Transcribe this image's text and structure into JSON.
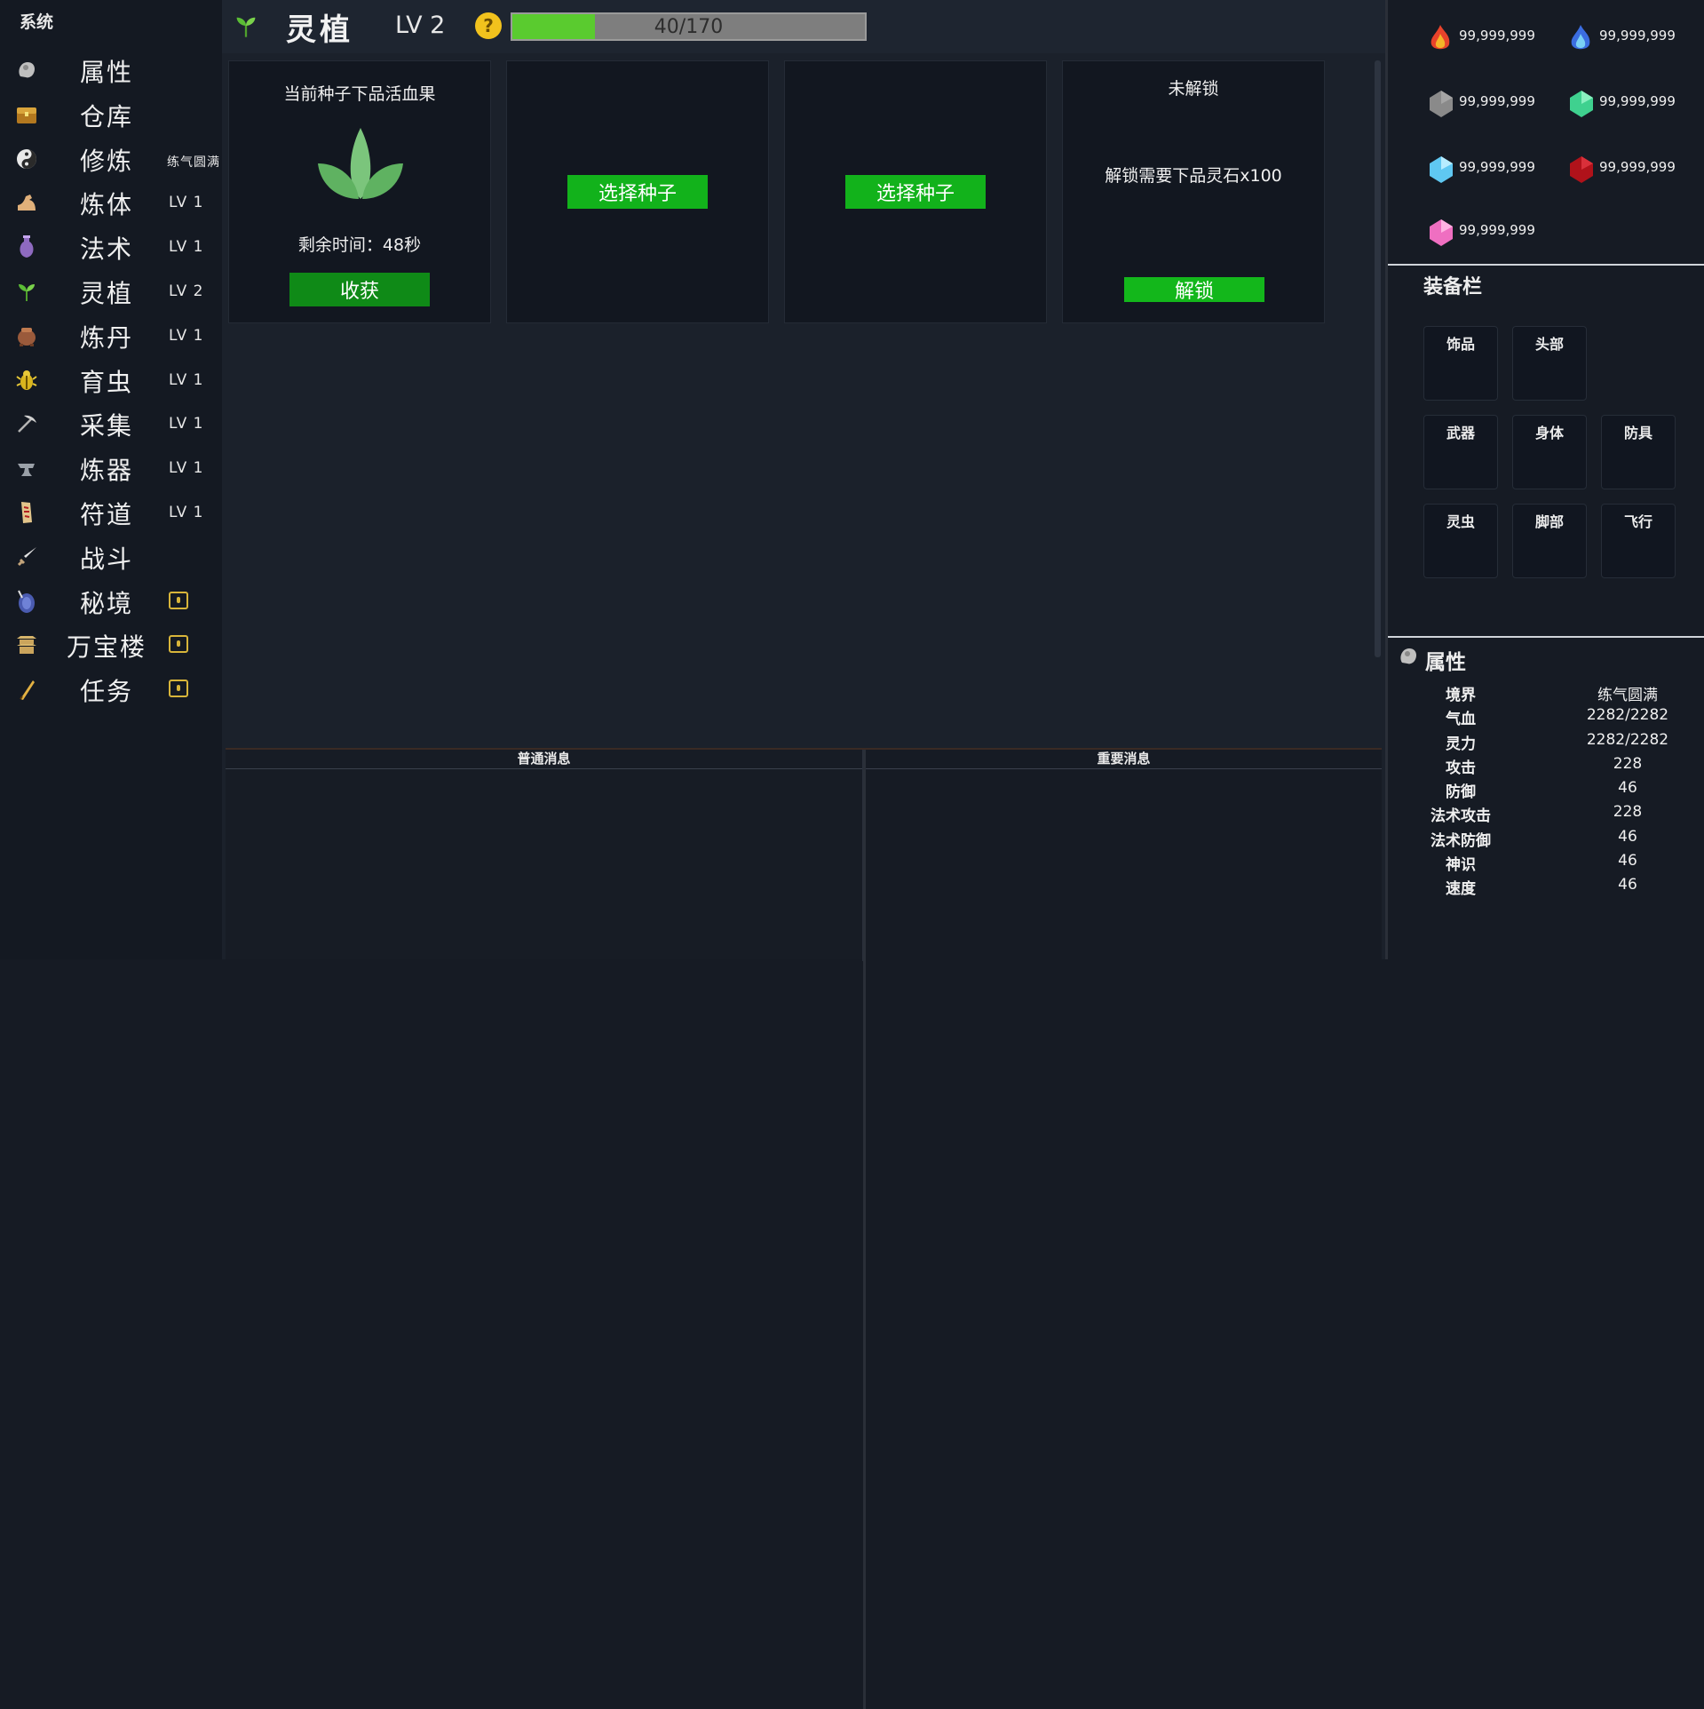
{
  "sidebar": {
    "system_label": "系统",
    "items": [
      {
        "label": "属性",
        "level": "",
        "icon": "attribute-icon"
      },
      {
        "label": "仓库",
        "level": "",
        "icon": "chest-icon"
      },
      {
        "label": "修炼",
        "level": "练气圆满",
        "icon": "yinyang-icon"
      },
      {
        "label": "炼体",
        "level": "LV 1",
        "icon": "arm-icon"
      },
      {
        "label": "法术",
        "level": "LV 1",
        "icon": "potion-icon"
      },
      {
        "label": "灵植",
        "level": "LV 2",
        "icon": "sprout-icon"
      },
      {
        "label": "炼丹",
        "level": "LV 1",
        "icon": "cauldron-icon"
      },
      {
        "label": "育虫",
        "level": "LV 1",
        "icon": "bug-icon"
      },
      {
        "label": "采集",
        "level": "LV 1",
        "icon": "pickaxe-icon"
      },
      {
        "label": "炼器",
        "level": "LV 1",
        "icon": "anvil-icon"
      },
      {
        "label": "符道",
        "level": "LV 1",
        "icon": "talisman-icon"
      },
      {
        "label": "战斗",
        "level": "",
        "icon": "sword-icon"
      },
      {
        "label": "秘境",
        "level": "",
        "icon": "portal-icon",
        "locked": true
      },
      {
        "label": "万宝楼",
        "level": "",
        "icon": "tower-icon",
        "locked": true
      },
      {
        "label": "任务",
        "level": "",
        "icon": "quill-icon",
        "locked": true
      }
    ]
  },
  "main": {
    "title": "灵植",
    "level": "LV 2",
    "help_glyph": "?",
    "xp_text": "40/170",
    "xp_fraction": 0.235,
    "plots": [
      {
        "title": "当前种子下品活血果",
        "timer": "剩余时间：48秒",
        "button": "收获"
      },
      {
        "button": "选择种子"
      },
      {
        "button": "选择种子"
      },
      {
        "title": "未解锁",
        "requirement": "解锁需要下品灵石x100",
        "button": "解锁"
      }
    ],
    "messages": {
      "normal": "普通消息",
      "important": "重要消息"
    }
  },
  "resources": [
    {
      "gem": "fire-gem-icon",
      "amount": "99,999,999",
      "color": "#e8432b"
    },
    {
      "gem": "blue-flame-gem-icon",
      "amount": "99,999,999",
      "color": "#3b6de0"
    },
    {
      "gem": "gray-gem-icon",
      "amount": "99,999,999",
      "color": "#8a8a8a"
    },
    {
      "gem": "green-gem-icon",
      "amount": "99,999,999",
      "color": "#3fd18f"
    },
    {
      "gem": "cyan-gem-icon",
      "amount": "99,999,999",
      "color": "#5fc8f2"
    },
    {
      "gem": "red-gem-icon",
      "amount": "99,999,999",
      "color": "#b0121a"
    },
    {
      "gem": "pink-gem-icon",
      "amount": "99,999,999",
      "color": "#ef6fc1"
    }
  ],
  "equipment": {
    "title": "装备栏",
    "slots": [
      "饰品",
      "头部",
      "武器",
      "身体",
      "防具",
      "灵虫",
      "脚部",
      "飞行"
    ]
  },
  "attributes": {
    "title": "属性",
    "rows": [
      {
        "k": "境界",
        "v": "练气圆满"
      },
      {
        "k": "气血",
        "v": "2282/2282"
      },
      {
        "k": "灵力",
        "v": "2282/2282"
      },
      {
        "k": "攻击",
        "v": "228"
      },
      {
        "k": "防御",
        "v": "46"
      },
      {
        "k": "法术攻击",
        "v": "228"
      },
      {
        "k": "法术防御",
        "v": "46"
      },
      {
        "k": "神识",
        "v": "46"
      },
      {
        "k": "速度",
        "v": "46"
      }
    ]
  }
}
